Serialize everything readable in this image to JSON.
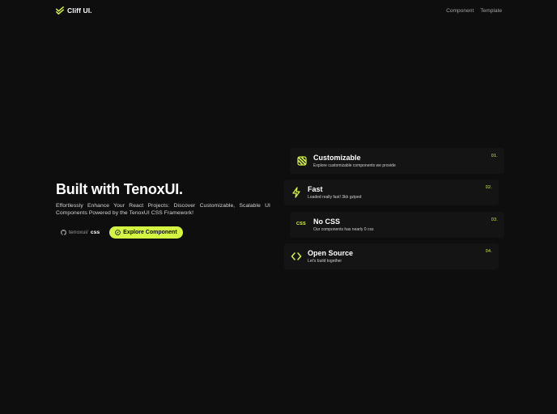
{
  "header": {
    "brand": "Cliff UI.",
    "brand_icon": "double-check-icon",
    "nav": [
      {
        "label": "Component"
      },
      {
        "label": "Template"
      }
    ]
  },
  "hero": {
    "title": "Built with TenoxUI.",
    "description": "Effortlessly Enhance Your React Projects: Discover Customizable, Scalable UI Components Powered by the TenoxUI CSS Framework!",
    "repo_prefix": "tenoxui/",
    "repo_name": "css",
    "repo_icon": "github-icon",
    "cta_label": "Explore Component",
    "cta_icon": "compass-icon"
  },
  "features": [
    {
      "title": "Customizable",
      "subtitle": "Explore customizable components we provide",
      "number": "01.",
      "icon": "brush-icon"
    },
    {
      "title": "Fast",
      "subtitle": "Loaded really fast! 3kb gziped",
      "number": "02.",
      "icon": "lightning-icon"
    },
    {
      "title": "No CSS",
      "subtitle": "Our components has nearly 0 css",
      "number": "03.",
      "icon": "css-icon",
      "badge": "CSS"
    },
    {
      "title": "Open Source",
      "subtitle": "Let's build together",
      "number": "04.",
      "icon": "code-icon"
    }
  ],
  "colors": {
    "background": "#0e0e0e",
    "card": "#141414",
    "accent": "#d4f542",
    "text": "#ffffff",
    "muted": "#a3a3a3"
  }
}
